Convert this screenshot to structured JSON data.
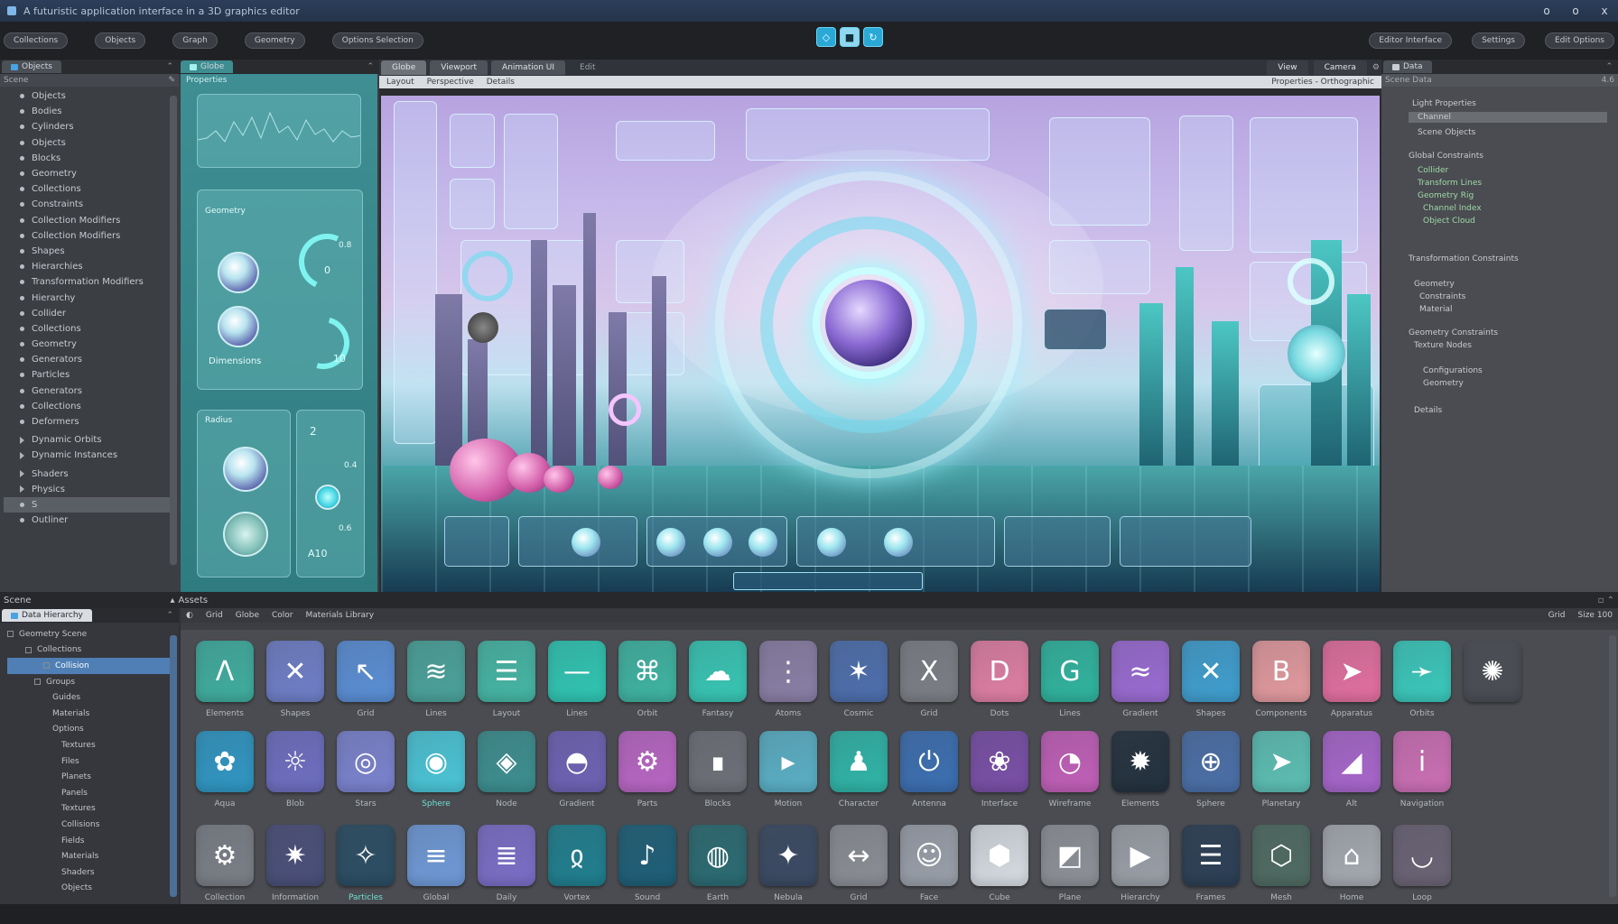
{
  "window": {
    "title": "A futuristic application interface in a 3D graphics editor",
    "controls": [
      "o",
      "o",
      "x"
    ]
  },
  "toolbar": {
    "left_buttons": [
      "Collections",
      "Objects",
      "Graph",
      "Geometry",
      "Options Selection"
    ],
    "center_icons": [
      "select-tool-icon",
      "move-tool-icon",
      "rotate-tool-icon"
    ],
    "right_buttons": [
      "Editor Interface",
      "Settings",
      "Edit Options"
    ]
  },
  "outliner": {
    "tab": "Objects",
    "header": "Scene",
    "items": [
      "Objects",
      "Bodies",
      "Cylinders",
      "Objects",
      "Blocks",
      "Geometry",
      "Collections",
      "Constraints",
      "Collection Modifiers",
      "Collection Modifiers",
      "Shapes",
      "Hierarchies",
      "Transformation Modifiers",
      "Hierarchy",
      "Collider",
      "Collections",
      "Geometry",
      "Generators",
      "Particles",
      "Generators",
      "Collections",
      "Deformers"
    ],
    "groups": [
      "Dynamic Orbits",
      "Dynamic Instances",
      "Shaders",
      "Physics"
    ],
    "search_value": "S",
    "footer": "Outliner"
  },
  "props": {
    "tab": "Globe",
    "header": "Properties",
    "card1": "Geometry",
    "v1": "0.8",
    "v2": "0",
    "v3": "10",
    "label1": "Dimensions",
    "card2": "Radius",
    "v4": "2",
    "v5": "0.4",
    "v6": "0.6",
    "v7": "A10"
  },
  "viewport": {
    "tabs": [
      "Globe",
      "Viewport",
      "Animation UI",
      "Edit"
    ],
    "sub_left": [
      "Layout",
      "Perspective",
      "Details"
    ],
    "sub_right": "Properties - Orthographic",
    "right_tabs": [
      "View",
      "Camera"
    ]
  },
  "inspector": {
    "tab": "Data",
    "header": "Scene Data",
    "value": "4.6",
    "lines": [
      "Light Properties",
      "Channel",
      "Scene Objects",
      "Global Constraints",
      "Collider",
      "Transform Lines",
      "Geometry Rig",
      "Channel Index",
      "Object Cloud",
      "Transformation Constraints",
      "Geometry",
      "Constraints",
      "Material",
      "Geometry Constraints",
      "Texture Nodes",
      "Configurations",
      "Geometry",
      "Details"
    ]
  },
  "bottom": {
    "left_title": "Scene",
    "center_title": "Assets",
    "tree_tab": "Data Hierarchy",
    "tree": [
      "Geometry Scene",
      "Collections",
      "Collision",
      "Groups",
      "Guides",
      "Materials",
      "Options",
      "Textures",
      "Files",
      "Planets",
      "Panels",
      "Textures",
      "Collisions",
      "Fields",
      "Materials",
      "Shaders",
      "Objects"
    ],
    "assets_head": [
      "Grid",
      "Globe",
      "Color",
      "Materials Library"
    ],
    "assets_right": [
      "Grid",
      "Size 100"
    ],
    "rows": [
      [
        {
          "g": "Λ",
          "c": "#3fae9f",
          "l": "Elements"
        },
        {
          "g": "✕",
          "c": "#6f7fc8",
          "l": "Shapes"
        },
        {
          "g": "↖",
          "c": "#5a8fd6",
          "l": "Grid"
        },
        {
          "g": "≋",
          "c": "#4aa39b",
          "l": "Lines"
        },
        {
          "g": "☰",
          "c": "#45b7a5",
          "l": "Layout"
        },
        {
          "g": "—",
          "c": "#2fc6b3",
          "l": "Lines"
        },
        {
          "g": "⌘",
          "c": "#3eb5a2",
          "l": "Orbit"
        },
        {
          "g": "☁",
          "c": "#37c7b5",
          "l": "Fantasy"
        },
        {
          "g": "⋮",
          "c": "#8a7fa6",
          "l": "Atoms"
        },
        {
          "g": "✶",
          "c": "#4d6fae",
          "l": "Cosmic"
        },
        {
          "g": "X",
          "c": "#7c7f86",
          "l": "Grid"
        },
        {
          "g": "D",
          "c": "#e07fa3",
          "l": "Dots"
        },
        {
          "g": "G",
          "c": "#2fb59f",
          "l": "Lines"
        },
        {
          "g": "≈",
          "c": "#9a6bd3",
          "l": "Gradient"
        },
        {
          "g": "✕",
          "c": "#3f9fd0",
          "l": "Shapes"
        },
        {
          "g": "B",
          "c": "#e39a9f",
          "l": "Components"
        },
        {
          "g": "➤",
          "c": "#e36fa0",
          "l": "Apparatus"
        },
        {
          "g": "➛",
          "c": "#3ac9bc",
          "l": "Orbits"
        },
        {
          "g": "✺",
          "c": "#4a4d54",
          "l": ""
        }
      ],
      [
        {
          "g": "✿",
          "c": "#2f97c4",
          "l": "Aqua"
        },
        {
          "g": "☼",
          "c": "#6e6ec2",
          "l": "Blob"
        },
        {
          "g": "◎",
          "c": "#7b83cf",
          "l": "Stars"
        },
        {
          "g": "◉",
          "c": "#4ac6d8",
          "l": "Sphere",
          "h": true
        },
        {
          "g": "◈",
          "c": "#3c8f90",
          "l": "Node"
        },
        {
          "g": "◓",
          "c": "#6e62b5",
          "l": "Gradient"
        },
        {
          "g": "⚙",
          "c": "#b966c4",
          "l": "Parts"
        },
        {
          "g": "∎",
          "c": "#6e7079",
          "l": "Blocks"
        },
        {
          "g": "▸",
          "c": "#5ab0c6",
          "l": "Motion"
        },
        {
          "g": "♟",
          "c": "#2fb5a8",
          "l": "Character"
        },
        {
          "g": "⏻",
          "c": "#3b6fb2",
          "l": "Antenna"
        },
        {
          "g": "❀",
          "c": "#7a4fa8",
          "l": "Interface"
        },
        {
          "g": "◔",
          "c": "#c25fb9",
          "l": "Wireframe"
        },
        {
          "g": "✹",
          "c": "#23313e",
          "l": "Elements"
        },
        {
          "g": "⊕",
          "c": "#4a6fa8",
          "l": "Sphere"
        },
        {
          "g": "➤",
          "c": "#5cc0b4",
          "l": "Planetary"
        },
        {
          "g": "◢",
          "c": "#a866cc",
          "l": "Alt"
        },
        {
          "g": "i",
          "c": "#cc6fb5",
          "l": "Navigation"
        }
      ],
      [
        {
          "g": "⚙",
          "c": "#7b7f87",
          "l": "Collection"
        },
        {
          "g": "✷",
          "c": "#4a4f7a",
          "l": "Information"
        },
        {
          "g": "✧",
          "c": "#2a4d63",
          "l": "Particles",
          "h": true
        },
        {
          "g": "≡",
          "c": "#6f9ad8",
          "l": "Global"
        },
        {
          "g": "≣",
          "c": "#7b6ec8",
          "l": "Daily"
        },
        {
          "g": "ჲ",
          "c": "#1f7f8f",
          "l": "Vortex"
        },
        {
          "g": "♪",
          "c": "#1d5f78",
          "l": "Sound"
        },
        {
          "g": "◍",
          "c": "#2a6b72",
          "l": "Earth"
        },
        {
          "g": "✦",
          "c": "#3a4a63",
          "l": "Nebula"
        },
        {
          "g": "↔",
          "c": "#8b8e95",
          "l": "Grid"
        },
        {
          "g": "☺",
          "c": "#9aa0aa",
          "l": "Face"
        },
        {
          "g": "⬢",
          "c": "#d7dde3",
          "l": "Cube"
        },
        {
          "g": "◩",
          "c": "#8e9298",
          "l": "Plane"
        },
        {
          "g": "▶",
          "c": "#9ba0a8",
          "l": "Hierarchy"
        },
        {
          "g": "☰",
          "c": "#2c3f55",
          "l": "Frames"
        },
        {
          "g": "⬡",
          "c": "#4e6b62",
          "l": "Mesh"
        },
        {
          "g": "⌂",
          "c": "#a6aab1",
          "l": "Home"
        },
        {
          "g": "◡",
          "c": "#6a6375",
          "l": "Loop"
        }
      ]
    ]
  }
}
